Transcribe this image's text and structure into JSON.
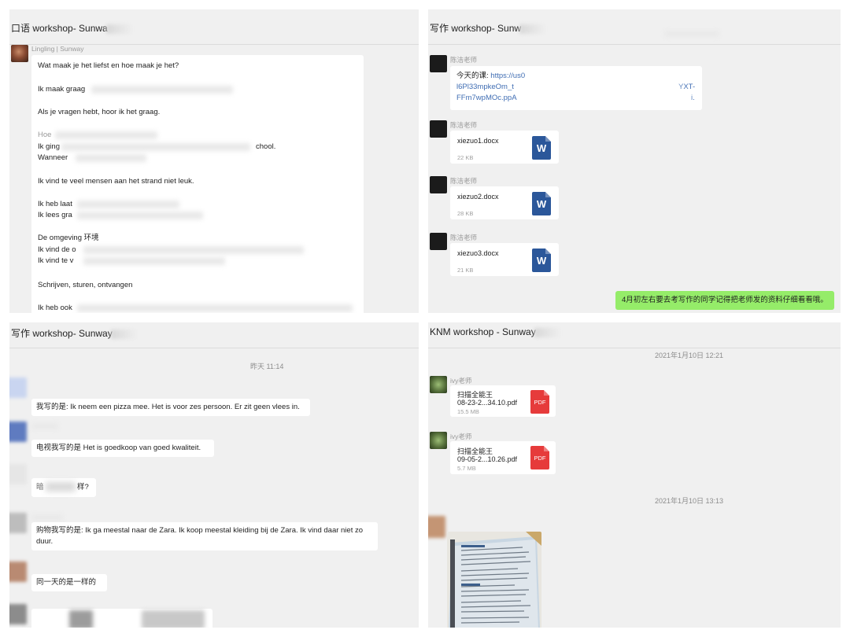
{
  "panel_tl": {
    "title": "口语 workshop- Sunwa",
    "sender": "Lingling | Sunway",
    "lines": [
      "Wat maak je het liefst en hoe maak je het?",
      "Ik maak graag",
      "Als je vragen hebt, hoor ik het graag.",
      "Hoe",
      "Ik ging",
      "Wanneer",
      "chool.",
      "Ik vind te veel mensen aan het strand niet leuk.",
      "Ik heb laat",
      "Ik lees gra",
      "De omgeving 环境",
      "Ik vind de o",
      "Ik vind te v",
      "Schrijven, sturen, ontvangen",
      "Ik heb ook"
    ]
  },
  "panel_tr": {
    "title": "写作  workshop- Sunw",
    "messages": [
      {
        "sender": "陈洁老师",
        "label": "今天的课:",
        "link_1": "https://us0",
        "link_2": "l6Pl33mpkeOm_t",
        "link_3": "FFm7wpMOc.ppA",
        "link_tail_1": "YXT-",
        "link_tail_2": "i."
      },
      {
        "sender": "陈洁老师",
        "file_name": "xiezuo1.docx",
        "file_size": "22 KB",
        "icon_letter": "W"
      },
      {
        "sender": "陈洁老师",
        "file_name": "xiezuo2.docx",
        "file_size": "28 KB",
        "icon_letter": "W"
      },
      {
        "sender": "陈洁老师",
        "file_name": "xiezuo3.docx",
        "file_size": "21 KB",
        "icon_letter": "W"
      }
    ],
    "self_message": "4月初左右要去考写作的同学记得把老师发的资料仔细看看哦。"
  },
  "panel_bl": {
    "title": "写作  workshop- Sunway",
    "timestamp": "昨天 11:14",
    "messages": [
      "我写的是: Ik neem een pizza mee. Het is voor zes persoon. Er zit geen vlees in.",
      "电视我写的是 Het is goedkoop van goed kwaliteit.",
      "暗",
      "样?",
      "购物我写的是: Ik ga meestal naar de Zara. Ik koop meestal kleiding bij de Zara. Ik vind daar niet zo",
      "duur.",
      "同一天的是一样的"
    ]
  },
  "panel_br": {
    "title": "KNM workshop - Sunway",
    "timestamp_1": "2021年1月10日 12:21",
    "timestamp_2": "2021年1月10日 13:13",
    "files": [
      {
        "sender": "ivy老师",
        "title": "扫描全能王",
        "name": "08-23-2...34.10.pdf",
        "size": "15.5 MB",
        "icon_label": "PDF"
      },
      {
        "sender": "ivy老师",
        "title": "扫描全能王",
        "name": "09-05-2...10.26.pdf",
        "size": "5.7 MB",
        "icon_label": "PDF"
      }
    ]
  },
  "colors": {
    "panel_bg": "#f0f0f0",
    "bubble_bg": "#ffffff",
    "self_bubble": "#95ec69",
    "link": "#3f6db3",
    "word_blue": "#2b579a",
    "pdf_red": "#e63b3b"
  }
}
